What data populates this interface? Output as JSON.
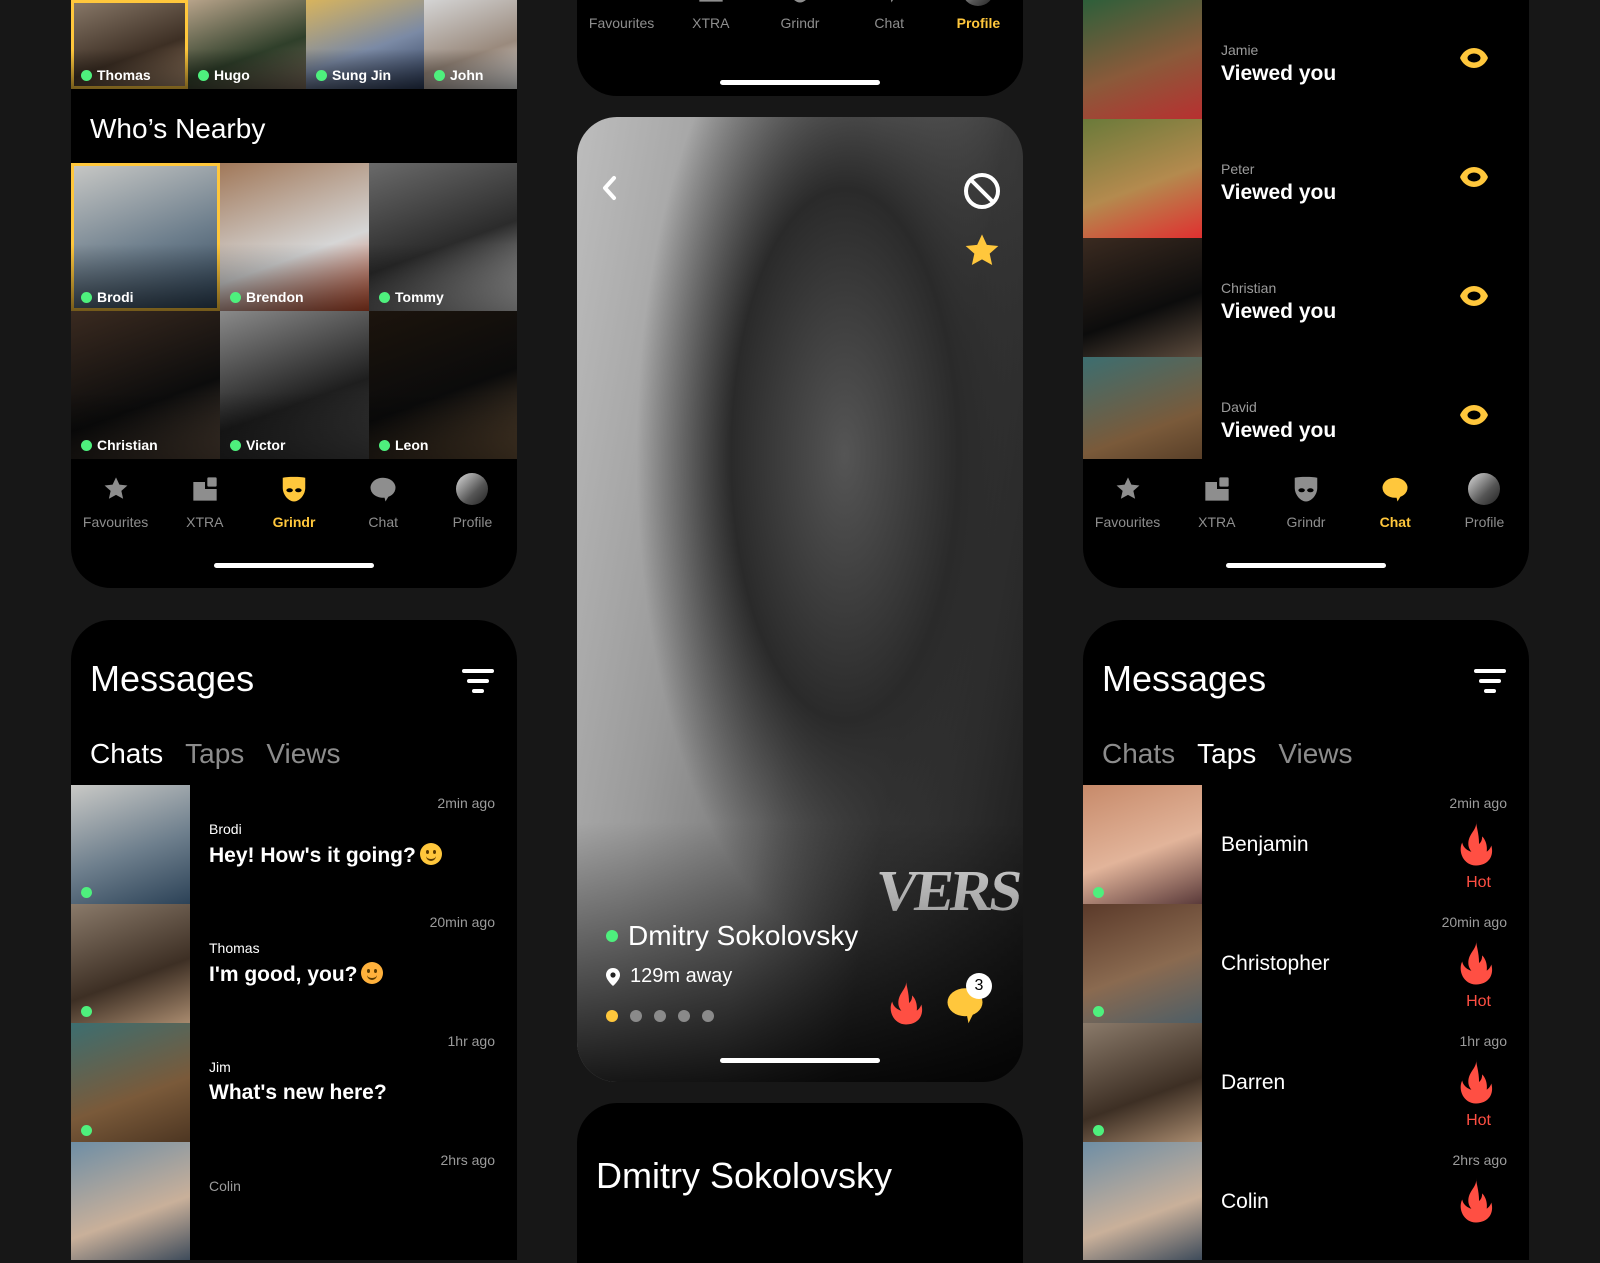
{
  "colors": {
    "accent": "#ffc73c",
    "online": "#4ef07d",
    "hot": "#ff4f43",
    "muted": "#8e8e8e",
    "background": "#171717"
  },
  "screen_nearby": {
    "top_row": [
      {
        "name": "Thomas",
        "selected": true
      },
      {
        "name": "Hugo"
      },
      {
        "name": "Sung Jin"
      },
      {
        "name": "John"
      }
    ],
    "section_title": "Who’s Nearby",
    "grid": [
      {
        "name": "Brodi",
        "selected": true
      },
      {
        "name": "Brendon"
      },
      {
        "name": "Tommy"
      },
      {
        "name": "Christian"
      },
      {
        "name": "Victor"
      },
      {
        "name": "Leon"
      }
    ]
  },
  "nav": {
    "items": [
      {
        "label": "Favourites",
        "icon": "star-icon"
      },
      {
        "label": "XTRA",
        "icon": "xtra-icon"
      },
      {
        "label": "Grindr",
        "icon": "grindr-mask-icon"
      },
      {
        "label": "Chat",
        "icon": "chat-bubble-icon"
      },
      {
        "label": "Profile",
        "icon": "profile-avatar-icon"
      }
    ],
    "active_nearby": "Grindr",
    "active_profile": "Profile",
    "active_views": "Chat"
  },
  "messages_chats": {
    "title": "Messages",
    "tabs": [
      "Chats",
      "Taps",
      "Views"
    ],
    "active_tab": "Chats",
    "rows": [
      {
        "name": "Brodi",
        "time": "2min ago",
        "text": "Hey! How's it going?",
        "emoji": "slightly-smiling-face",
        "online": true
      },
      {
        "name": "Thomas",
        "time": "20min ago",
        "text": "I'm good, you?",
        "emoji": "smiling-face-with-hearts",
        "online": true
      },
      {
        "name": "Jim",
        "time": "1hr ago",
        "text": "What's new here?",
        "online": true
      },
      {
        "name": "Colin",
        "time": "2hrs ago",
        "text": ""
      }
    ]
  },
  "profile": {
    "name": "Dmitry Sokolovsky",
    "distance": "129m away",
    "online": true,
    "photo_count": 5,
    "active_photo": 1,
    "chat_badge": "3",
    "shirt_text": "VERS"
  },
  "profile_detail": {
    "name": "Dmitry Sokolovsky"
  },
  "views": {
    "rows": [
      {
        "name": "Jamie",
        "text": "Viewed you"
      },
      {
        "name": "Peter",
        "text": "Viewed you"
      },
      {
        "name": "Christian",
        "text": "Viewed you"
      },
      {
        "name": "David",
        "text": "Viewed you"
      }
    ]
  },
  "messages_taps": {
    "title": "Messages",
    "tabs": [
      "Chats",
      "Taps",
      "Views"
    ],
    "active_tab": "Taps",
    "rows": [
      {
        "name": "Benjamin",
        "time": "2min ago",
        "tag": "Hot",
        "online": true
      },
      {
        "name": "Christopher",
        "time": "20min ago",
        "tag": "Hot",
        "online": true
      },
      {
        "name": "Darren",
        "time": "1hr ago",
        "tag": "Hot",
        "online": true
      },
      {
        "name": "Colin",
        "time": "2hrs ago",
        "tag": "Hot"
      }
    ]
  }
}
